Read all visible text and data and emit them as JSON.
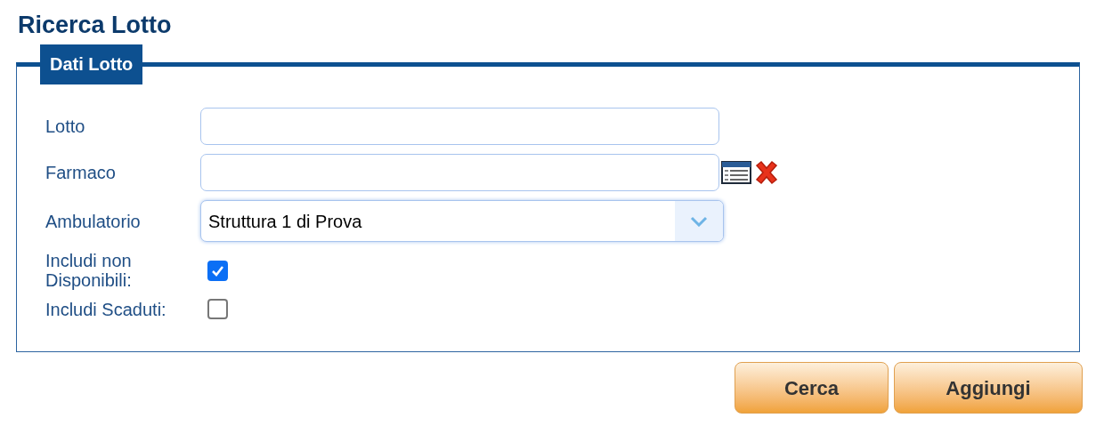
{
  "title": "Ricerca Lotto",
  "section": {
    "legend": "Dati Lotto",
    "fields": [
      {
        "kind": "text",
        "label": "Lotto"
      },
      {
        "kind": "lookup",
        "label": "Farmaco"
      },
      {
        "kind": "select",
        "label": "Ambulatorio",
        "value": "Struttura 1 di Prova"
      },
      {
        "kind": "checkbox",
        "label": "Includi non Disponibili:",
        "checked": true
      },
      {
        "kind": "checkbox",
        "label": "Includi Scaduti:",
        "checked": false
      }
    ]
  },
  "buttons": [
    "Cerca",
    "Aggiungi"
  ]
}
